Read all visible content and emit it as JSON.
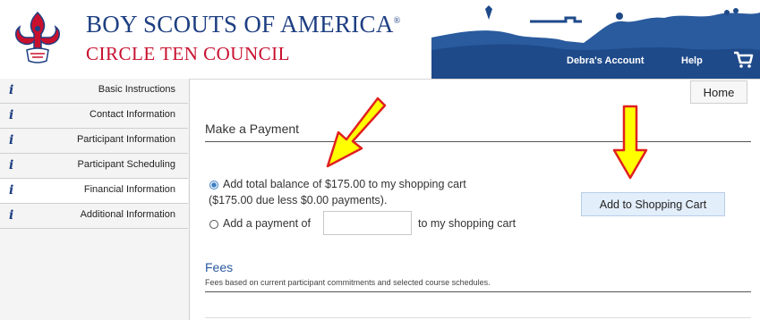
{
  "header": {
    "org_name": "BOY SCOUTS OF AMERICA",
    "registered_mark": "®",
    "council_name": "CIRCLE TEN COUNCIL",
    "nav": {
      "account": "Debra's Account",
      "help": "Help",
      "cart_icon": "shopping-cart-icon"
    }
  },
  "sidebar": {
    "items": [
      {
        "label": "Basic Instructions",
        "icon": "info-icon",
        "active": false
      },
      {
        "label": "Contact Information",
        "icon": "info-icon",
        "active": false
      },
      {
        "label": "Participant Information",
        "icon": "info-icon",
        "active": false
      },
      {
        "label": "Participant Scheduling",
        "icon": "info-icon",
        "active": false
      },
      {
        "label": "Financial Information",
        "icon": "info-icon",
        "active": true
      },
      {
        "label": "Additional Information",
        "icon": "info-icon",
        "active": false
      }
    ],
    "info_glyph": "i"
  },
  "main": {
    "home_button": "Home",
    "payment_section": {
      "title": "Make a Payment",
      "option_total": "Add total balance of $175.00 to my shopping cart",
      "option_total_detail": "($175.00 due less $0.00 payments).",
      "option_partial_prefix": "Add a payment of",
      "option_partial_suffix": "to my shopping cart",
      "payment_input_value": "",
      "add_to_cart_button": "Add to Shopping Cart"
    },
    "fees_section": {
      "title": "Fees",
      "description": "Fees based on current participant commitments and selected course schedules."
    }
  },
  "colors": {
    "brand_blue": "#1e3f82",
    "brand_red": "#c8102e",
    "annotation_arrow": "#ffff00",
    "annotation_outline": "#e02020"
  }
}
